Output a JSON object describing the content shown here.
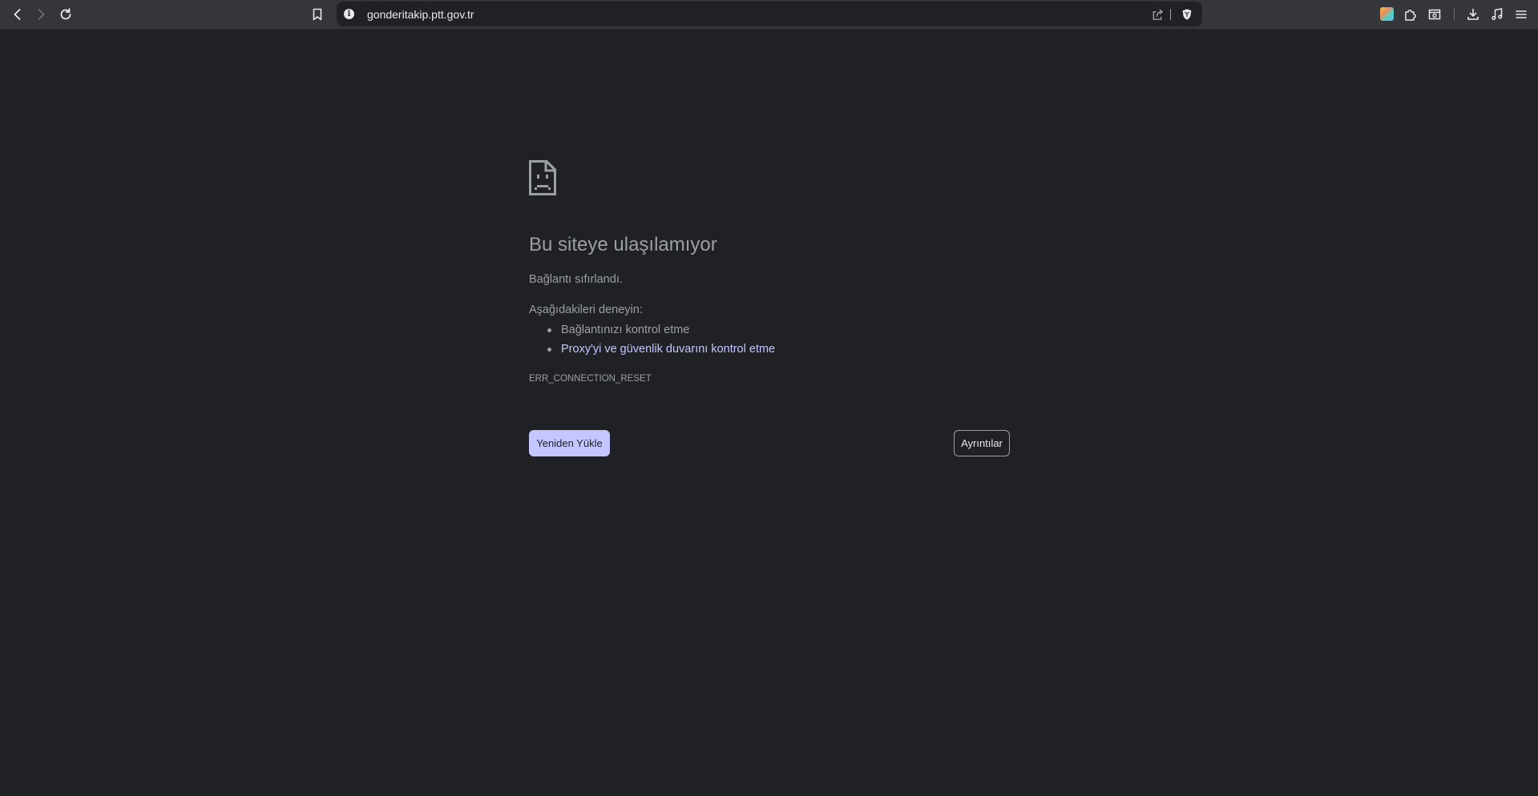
{
  "browser": {
    "url": "gonderitakip.ptt.gov.tr"
  },
  "error_page": {
    "title": "Bu siteye ulaşılamıyor",
    "description": "Bağlantı sıfırlandı.",
    "try_label": "Aşağıdakileri deneyin:",
    "suggestions": [
      {
        "label": "Bağlantınızı kontrol etme",
        "is_link": false
      },
      {
        "label": "Proxy'yi ve güvenlik duvarını kontrol etme",
        "is_link": true
      }
    ],
    "error_code": "ERR_CONNECTION_RESET",
    "reload_button": "Yeniden Yükle",
    "details_button": "Ayrıntılar"
  },
  "colors": {
    "page_background": "#202124",
    "toolbar_background": "#35363a",
    "text": "#9aa0a6",
    "accent": "#c4c7ff"
  },
  "icons": {
    "toolbar": [
      "back-arrow-icon",
      "forward-arrow-icon",
      "reload-icon",
      "bookmark-icon"
    ],
    "omnibox": [
      "info-icon",
      "share-icon",
      "brave-shields-icon"
    ],
    "extensions": [
      "colorful-extension-icon",
      "puzzle-extensions-icon",
      "screenshot-icon",
      "download-icon",
      "music-note-icon",
      "menu-icon"
    ],
    "error": "sad-document-icon"
  }
}
